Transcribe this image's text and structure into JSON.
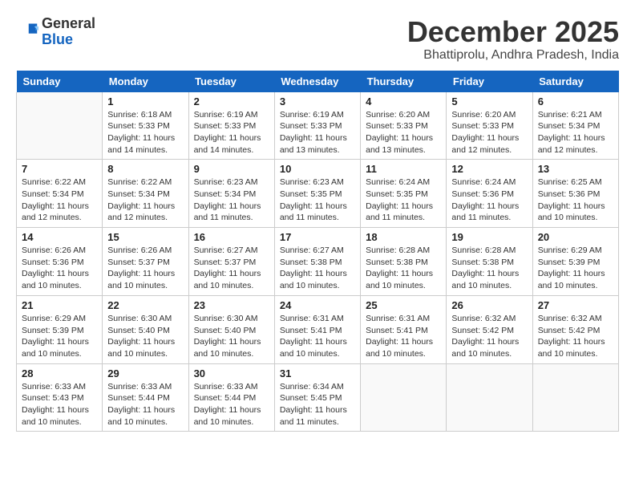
{
  "logo": {
    "general": "General",
    "blue": "Blue"
  },
  "title": "December 2025",
  "location": "Bhattiprolu, Andhra Pradesh, India",
  "days_header": [
    "Sunday",
    "Monday",
    "Tuesday",
    "Wednesday",
    "Thursday",
    "Friday",
    "Saturday"
  ],
  "weeks": [
    [
      {
        "day": "",
        "info": ""
      },
      {
        "day": "1",
        "info": "Sunrise: 6:18 AM\nSunset: 5:33 PM\nDaylight: 11 hours\nand 14 minutes."
      },
      {
        "day": "2",
        "info": "Sunrise: 6:19 AM\nSunset: 5:33 PM\nDaylight: 11 hours\nand 14 minutes."
      },
      {
        "day": "3",
        "info": "Sunrise: 6:19 AM\nSunset: 5:33 PM\nDaylight: 11 hours\nand 13 minutes."
      },
      {
        "day": "4",
        "info": "Sunrise: 6:20 AM\nSunset: 5:33 PM\nDaylight: 11 hours\nand 13 minutes."
      },
      {
        "day": "5",
        "info": "Sunrise: 6:20 AM\nSunset: 5:33 PM\nDaylight: 11 hours\nand 12 minutes."
      },
      {
        "day": "6",
        "info": "Sunrise: 6:21 AM\nSunset: 5:34 PM\nDaylight: 11 hours\nand 12 minutes."
      }
    ],
    [
      {
        "day": "7",
        "info": "Sunrise: 6:22 AM\nSunset: 5:34 PM\nDaylight: 11 hours\nand 12 minutes."
      },
      {
        "day": "8",
        "info": "Sunrise: 6:22 AM\nSunset: 5:34 PM\nDaylight: 11 hours\nand 12 minutes."
      },
      {
        "day": "9",
        "info": "Sunrise: 6:23 AM\nSunset: 5:34 PM\nDaylight: 11 hours\nand 11 minutes."
      },
      {
        "day": "10",
        "info": "Sunrise: 6:23 AM\nSunset: 5:35 PM\nDaylight: 11 hours\nand 11 minutes."
      },
      {
        "day": "11",
        "info": "Sunrise: 6:24 AM\nSunset: 5:35 PM\nDaylight: 11 hours\nand 11 minutes."
      },
      {
        "day": "12",
        "info": "Sunrise: 6:24 AM\nSunset: 5:36 PM\nDaylight: 11 hours\nand 11 minutes."
      },
      {
        "day": "13",
        "info": "Sunrise: 6:25 AM\nSunset: 5:36 PM\nDaylight: 11 hours\nand 10 minutes."
      }
    ],
    [
      {
        "day": "14",
        "info": "Sunrise: 6:26 AM\nSunset: 5:36 PM\nDaylight: 11 hours\nand 10 minutes."
      },
      {
        "day": "15",
        "info": "Sunrise: 6:26 AM\nSunset: 5:37 PM\nDaylight: 11 hours\nand 10 minutes."
      },
      {
        "day": "16",
        "info": "Sunrise: 6:27 AM\nSunset: 5:37 PM\nDaylight: 11 hours\nand 10 minutes."
      },
      {
        "day": "17",
        "info": "Sunrise: 6:27 AM\nSunset: 5:38 PM\nDaylight: 11 hours\nand 10 minutes."
      },
      {
        "day": "18",
        "info": "Sunrise: 6:28 AM\nSunset: 5:38 PM\nDaylight: 11 hours\nand 10 minutes."
      },
      {
        "day": "19",
        "info": "Sunrise: 6:28 AM\nSunset: 5:38 PM\nDaylight: 11 hours\nand 10 minutes."
      },
      {
        "day": "20",
        "info": "Sunrise: 6:29 AM\nSunset: 5:39 PM\nDaylight: 11 hours\nand 10 minutes."
      }
    ],
    [
      {
        "day": "21",
        "info": "Sunrise: 6:29 AM\nSunset: 5:39 PM\nDaylight: 11 hours\nand 10 minutes."
      },
      {
        "day": "22",
        "info": "Sunrise: 6:30 AM\nSunset: 5:40 PM\nDaylight: 11 hours\nand 10 minutes."
      },
      {
        "day": "23",
        "info": "Sunrise: 6:30 AM\nSunset: 5:40 PM\nDaylight: 11 hours\nand 10 minutes."
      },
      {
        "day": "24",
        "info": "Sunrise: 6:31 AM\nSunset: 5:41 PM\nDaylight: 11 hours\nand 10 minutes."
      },
      {
        "day": "25",
        "info": "Sunrise: 6:31 AM\nSunset: 5:41 PM\nDaylight: 11 hours\nand 10 minutes."
      },
      {
        "day": "26",
        "info": "Sunrise: 6:32 AM\nSunset: 5:42 PM\nDaylight: 11 hours\nand 10 minutes."
      },
      {
        "day": "27",
        "info": "Sunrise: 6:32 AM\nSunset: 5:42 PM\nDaylight: 11 hours\nand 10 minutes."
      }
    ],
    [
      {
        "day": "28",
        "info": "Sunrise: 6:33 AM\nSunset: 5:43 PM\nDaylight: 11 hours\nand 10 minutes."
      },
      {
        "day": "29",
        "info": "Sunrise: 6:33 AM\nSunset: 5:44 PM\nDaylight: 11 hours\nand 10 minutes."
      },
      {
        "day": "30",
        "info": "Sunrise: 6:33 AM\nSunset: 5:44 PM\nDaylight: 11 hours\nand 10 minutes."
      },
      {
        "day": "31",
        "info": "Sunrise: 6:34 AM\nSunset: 5:45 PM\nDaylight: 11 hours\nand 11 minutes."
      },
      {
        "day": "",
        "info": ""
      },
      {
        "day": "",
        "info": ""
      },
      {
        "day": "",
        "info": ""
      }
    ]
  ]
}
